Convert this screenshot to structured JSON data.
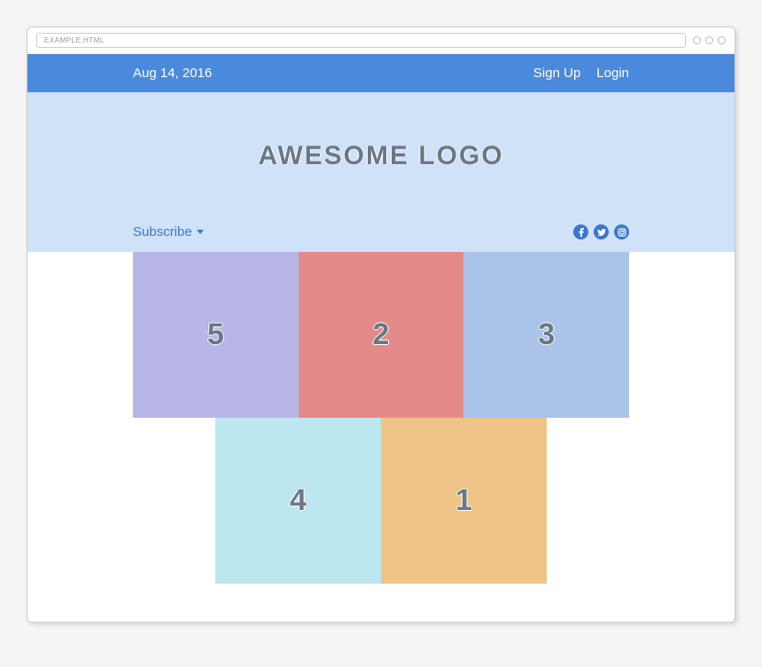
{
  "browser": {
    "address_text": "EXAMPLE.HTML"
  },
  "topbar": {
    "date": "Aug 14, 2016",
    "signup": "Sign Up",
    "login": "Login"
  },
  "hero": {
    "logo": "AWESOME LOGO",
    "subscribe": "Subscribe",
    "social": {
      "facebook": "f",
      "twitter": "t",
      "instagram": "i"
    }
  },
  "tiles": {
    "row1": [
      {
        "label": "5",
        "color": "purple"
      },
      {
        "label": "2",
        "color": "red"
      },
      {
        "label": "3",
        "color": "blue"
      }
    ],
    "row2": [
      {
        "label": "4",
        "color": "cyan"
      },
      {
        "label": "1",
        "color": "orange"
      }
    ]
  }
}
